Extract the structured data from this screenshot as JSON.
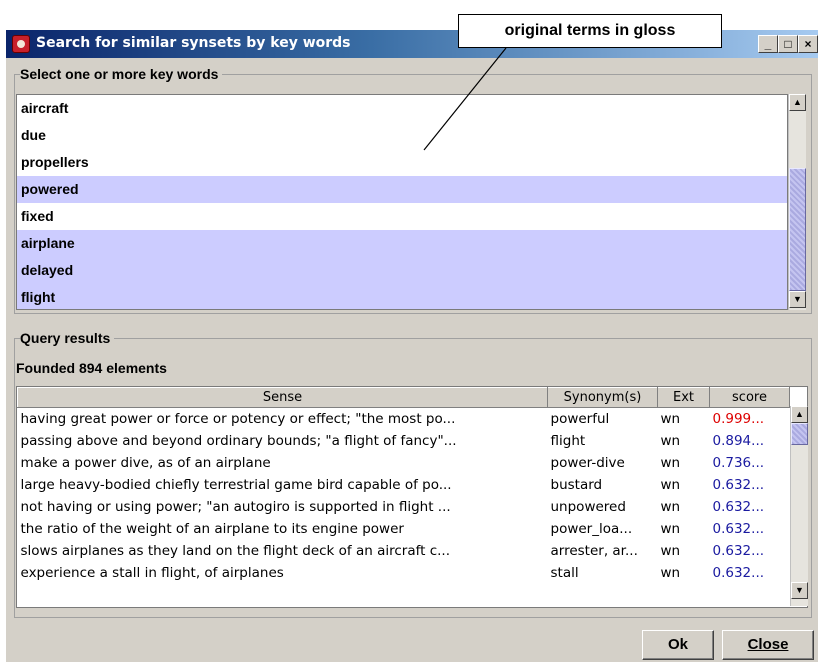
{
  "window": {
    "title": "Search for similar synsets by key words",
    "controls": [
      "_",
      "□",
      "×"
    ]
  },
  "annotation": {
    "text": "original terms in gloss"
  },
  "keywords": {
    "group_label": "Select one or more key words",
    "items": [
      {
        "label": "aircraft",
        "selected": false
      },
      {
        "label": "due",
        "selected": false
      },
      {
        "label": "propellers",
        "selected": false
      },
      {
        "label": "powered",
        "selected": true
      },
      {
        "label": "fixed",
        "selected": false
      },
      {
        "label": "airplane",
        "selected": true
      },
      {
        "label": "delayed",
        "selected": true
      },
      {
        "label": "flight",
        "selected": true
      }
    ]
  },
  "results": {
    "group_label": "Query results",
    "count_text": "Founded 894 elements",
    "columns": [
      "Sense",
      "Synonym(s)",
      "Ext",
      "score"
    ],
    "rows": [
      {
        "sense": "having great power or force or potency or effect; \"the most po...",
        "synonyms": "powerful",
        "ext": "wn",
        "score": "0.999..."
      },
      {
        "sense": "passing above and beyond ordinary bounds; \"a flight of fancy\"...",
        "synonyms": "flight",
        "ext": "wn",
        "score": "0.894..."
      },
      {
        "sense": "make a power dive, as of an airplane",
        "synonyms": "power-dive",
        "ext": "wn",
        "score": "0.736..."
      },
      {
        "sense": "large heavy-bodied chiefly terrestrial game bird capable of po...",
        "synonyms": "bustard",
        "ext": "wn",
        "score": "0.632..."
      },
      {
        "sense": "not having or using power; \"an autogiro is supported in flight ...",
        "synonyms": "unpowered",
        "ext": "wn",
        "score": "0.632..."
      },
      {
        "sense": "the ratio of the weight of an airplane to its engine power",
        "synonyms": "power_loa...",
        "ext": "wn",
        "score": "0.632..."
      },
      {
        "sense": "slows airplanes as they land on the flight deck of an aircraft c...",
        "synonyms": "arrester, ar...",
        "ext": "wn",
        "score": "0.632..."
      },
      {
        "sense": "experience a stall in flight, of airplanes",
        "synonyms": "stall",
        "ext": "wn",
        "score": "0.632..."
      }
    ]
  },
  "buttons": {
    "ok": "Ok",
    "close": "Close"
  },
  "colors": {
    "selection": "#ccccff",
    "top_score": "#dd0000",
    "score": "#1a1aa0",
    "title_gradient_start": "#0a246a"
  }
}
